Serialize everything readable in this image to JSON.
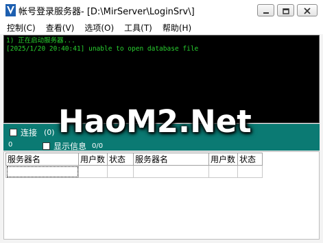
{
  "window": {
    "title": "帐号登录服务器-  [D:\\MirServer\\LoginSrv\\]",
    "icon": "v-app-icon",
    "controls": [
      "minimize-icon",
      "maximize-icon",
      "close-icon"
    ]
  },
  "menu": {
    "items": [
      {
        "label": "控制(C)"
      },
      {
        "label": "查看(V)"
      },
      {
        "label": "选项(O)"
      },
      {
        "label": "工具(T)"
      },
      {
        "label": "帮助(H)"
      }
    ]
  },
  "console": {
    "lines": [
      "1) 正在启动服务器...",
      "[2025/1/20 20:40:41] unable to open database file"
    ],
    "text_color": "#29d130"
  },
  "status": {
    "connect_label": "连接",
    "connect_count": "(0)",
    "left_count": "0",
    "show_info_label": "显示信息",
    "info_count": "0/0",
    "panel_color": "#0b7a73"
  },
  "watermark": "HaoM2.Net",
  "table": {
    "headers": [
      "服务器名",
      "用户数",
      "状态",
      "服务器名",
      "用户数",
      "状态"
    ],
    "rows": [
      [
        "",
        "",
        "",
        "",
        "",
        ""
      ]
    ]
  }
}
